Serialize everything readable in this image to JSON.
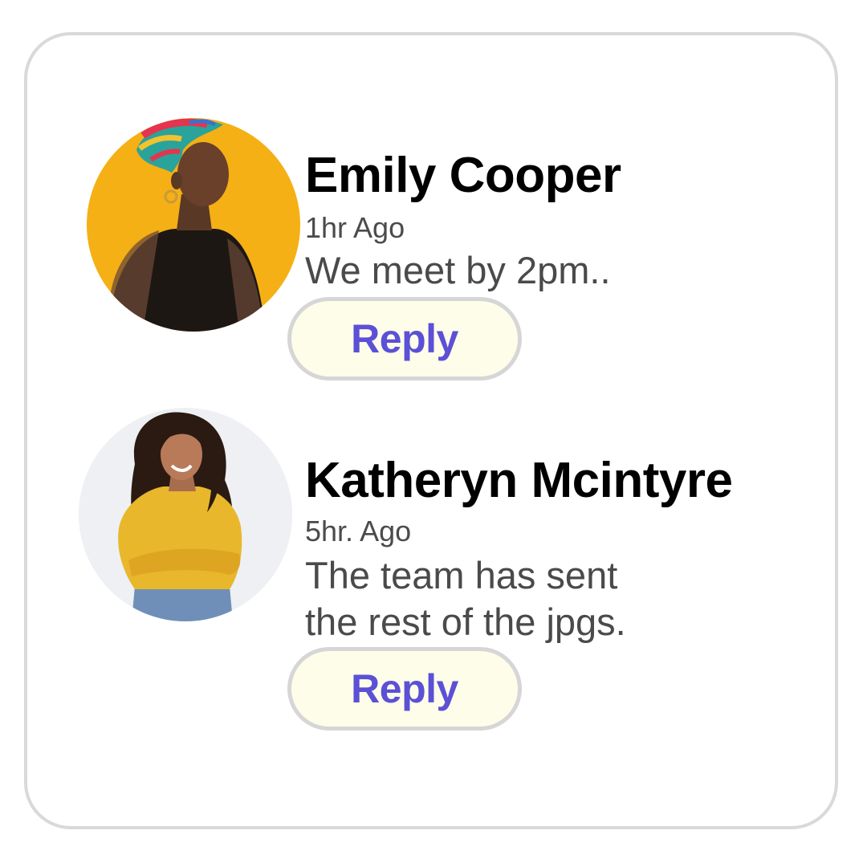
{
  "comments": [
    {
      "author": "Emily Cooper",
      "time": "1hr Ago",
      "message_lines": [
        "We meet by 2pm.."
      ],
      "reply_label": "Reply",
      "avatar_bg": "#f5b015"
    },
    {
      "author": "Katheryn Mcintyre",
      "time": "5hr. Ago",
      "message_lines": [
        "The team has sent",
        "the rest of the jpgs."
      ],
      "reply_label": "Reply",
      "avatar_bg": "#eef0f3"
    }
  ],
  "colors": {
    "reply_text": "#5b50d6",
    "reply_bg": "#fdfde9",
    "card_border": "#d9d9d9"
  }
}
